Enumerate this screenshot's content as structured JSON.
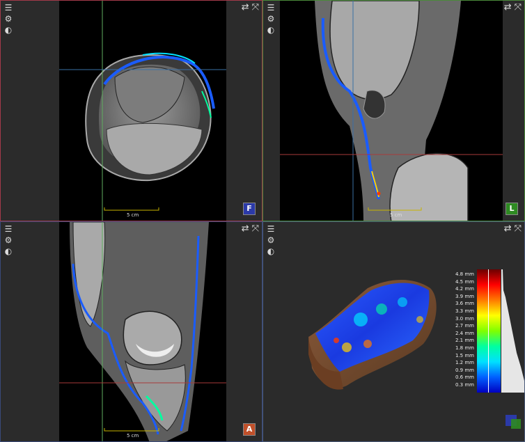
{
  "panels": {
    "axial": {
      "badge": "F",
      "badge_color": "#2b3aa8",
      "scale_label": "5 cm"
    },
    "sagittal": {
      "badge": "L",
      "badge_color": "#2e8a22",
      "scale_label": "5 cm"
    },
    "coronal": {
      "badge": "A",
      "badge_color": "#c0502a",
      "scale_label": "5 cm"
    },
    "volume": {}
  },
  "icons": {
    "menu": "hamburger-menu-icon",
    "settings": "gear-icon",
    "contrast": "contrast-icon",
    "swap": "swap-arrows-icon",
    "maximize": "maximize-icon"
  },
  "colorbar": {
    "labels": [
      "4.8 mm",
      "4.5 mm",
      "4.2 mm",
      "3.9 mm",
      "3.6 mm",
      "3.3 mm",
      "3.0 mm",
      "2.7 mm",
      "2.4 mm",
      "2.1 mm",
      "1.8 mm",
      "1.5 mm",
      "1.2 mm",
      "0.9 mm",
      "0.6 mm",
      "0.3 mm"
    ]
  }
}
